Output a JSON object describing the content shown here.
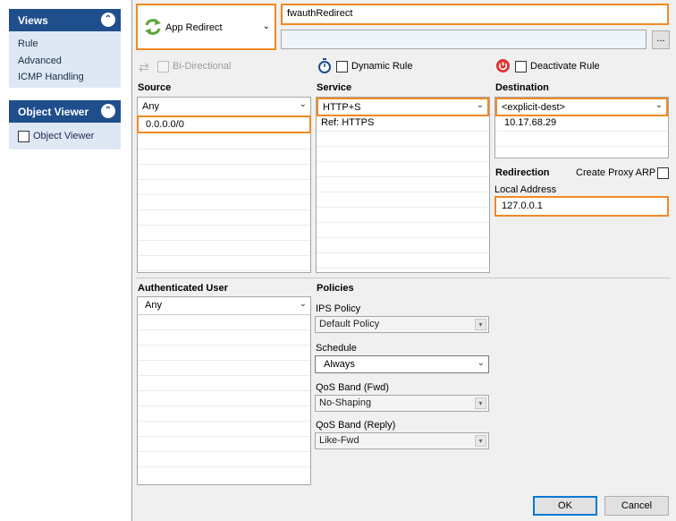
{
  "views_pane": {
    "title": "Views",
    "items": [
      "Rule",
      "Advanced",
      "ICMP Handling"
    ]
  },
  "object_viewer_pane": {
    "title": "Object Viewer",
    "checkbox_label": "Object Viewer"
  },
  "action": {
    "label": "App Redirect"
  },
  "rule": {
    "name": "fwauthRedirect",
    "description": "",
    "browse_label": "..."
  },
  "options": {
    "bidirectional_label": "Bi-Directional",
    "dynamic_rule_label": "Dynamic Rule",
    "deactivate_rule_label": "Deactivate Rule"
  },
  "source": {
    "title": "Source",
    "selected": "Any",
    "rows": [
      "0.0.0.0/0",
      "",
      "",
      "",
      "",
      "",
      "",
      "",
      "",
      "",
      ""
    ]
  },
  "service": {
    "title": "Service",
    "selected": "HTTP+S",
    "rows": [
      "Ref: HTTPS",
      "",
      "",
      "",
      "",
      "",
      "",
      "",
      "",
      ""
    ]
  },
  "destination": {
    "title": "Destination",
    "selected": "<explicit-dest>",
    "rows": [
      "10.17.68.29",
      "",
      ""
    ]
  },
  "redirection": {
    "title": "Redirection",
    "proxy_arp_label": "Create Proxy ARP",
    "local_address_label": "Local Address",
    "local_address": "127.0.0.1"
  },
  "auth_user": {
    "title": "Authenticated User",
    "selected": "Any",
    "rows": [
      "",
      "",
      "",
      "",
      "",
      "",
      "",
      "",
      "",
      ""
    ]
  },
  "policies": {
    "title": "Policies",
    "ips_label": "IPS Policy",
    "ips_value": "Default Policy",
    "schedule_label": "Schedule",
    "schedule_value": "Always",
    "qos_fwd_label": "QoS Band (Fwd)",
    "qos_fwd_value": "No-Shaping",
    "qos_reply_label": "QoS Band (Reply)",
    "qos_reply_value": "Like-Fwd"
  },
  "buttons": {
    "ok": "OK",
    "cancel": "Cancel"
  },
  "colors": {
    "highlight": "#f08a24",
    "pane_header": "#1f4e8c",
    "redirect_icon": "#5aa63a",
    "deactivate_icon": "#e03131"
  }
}
